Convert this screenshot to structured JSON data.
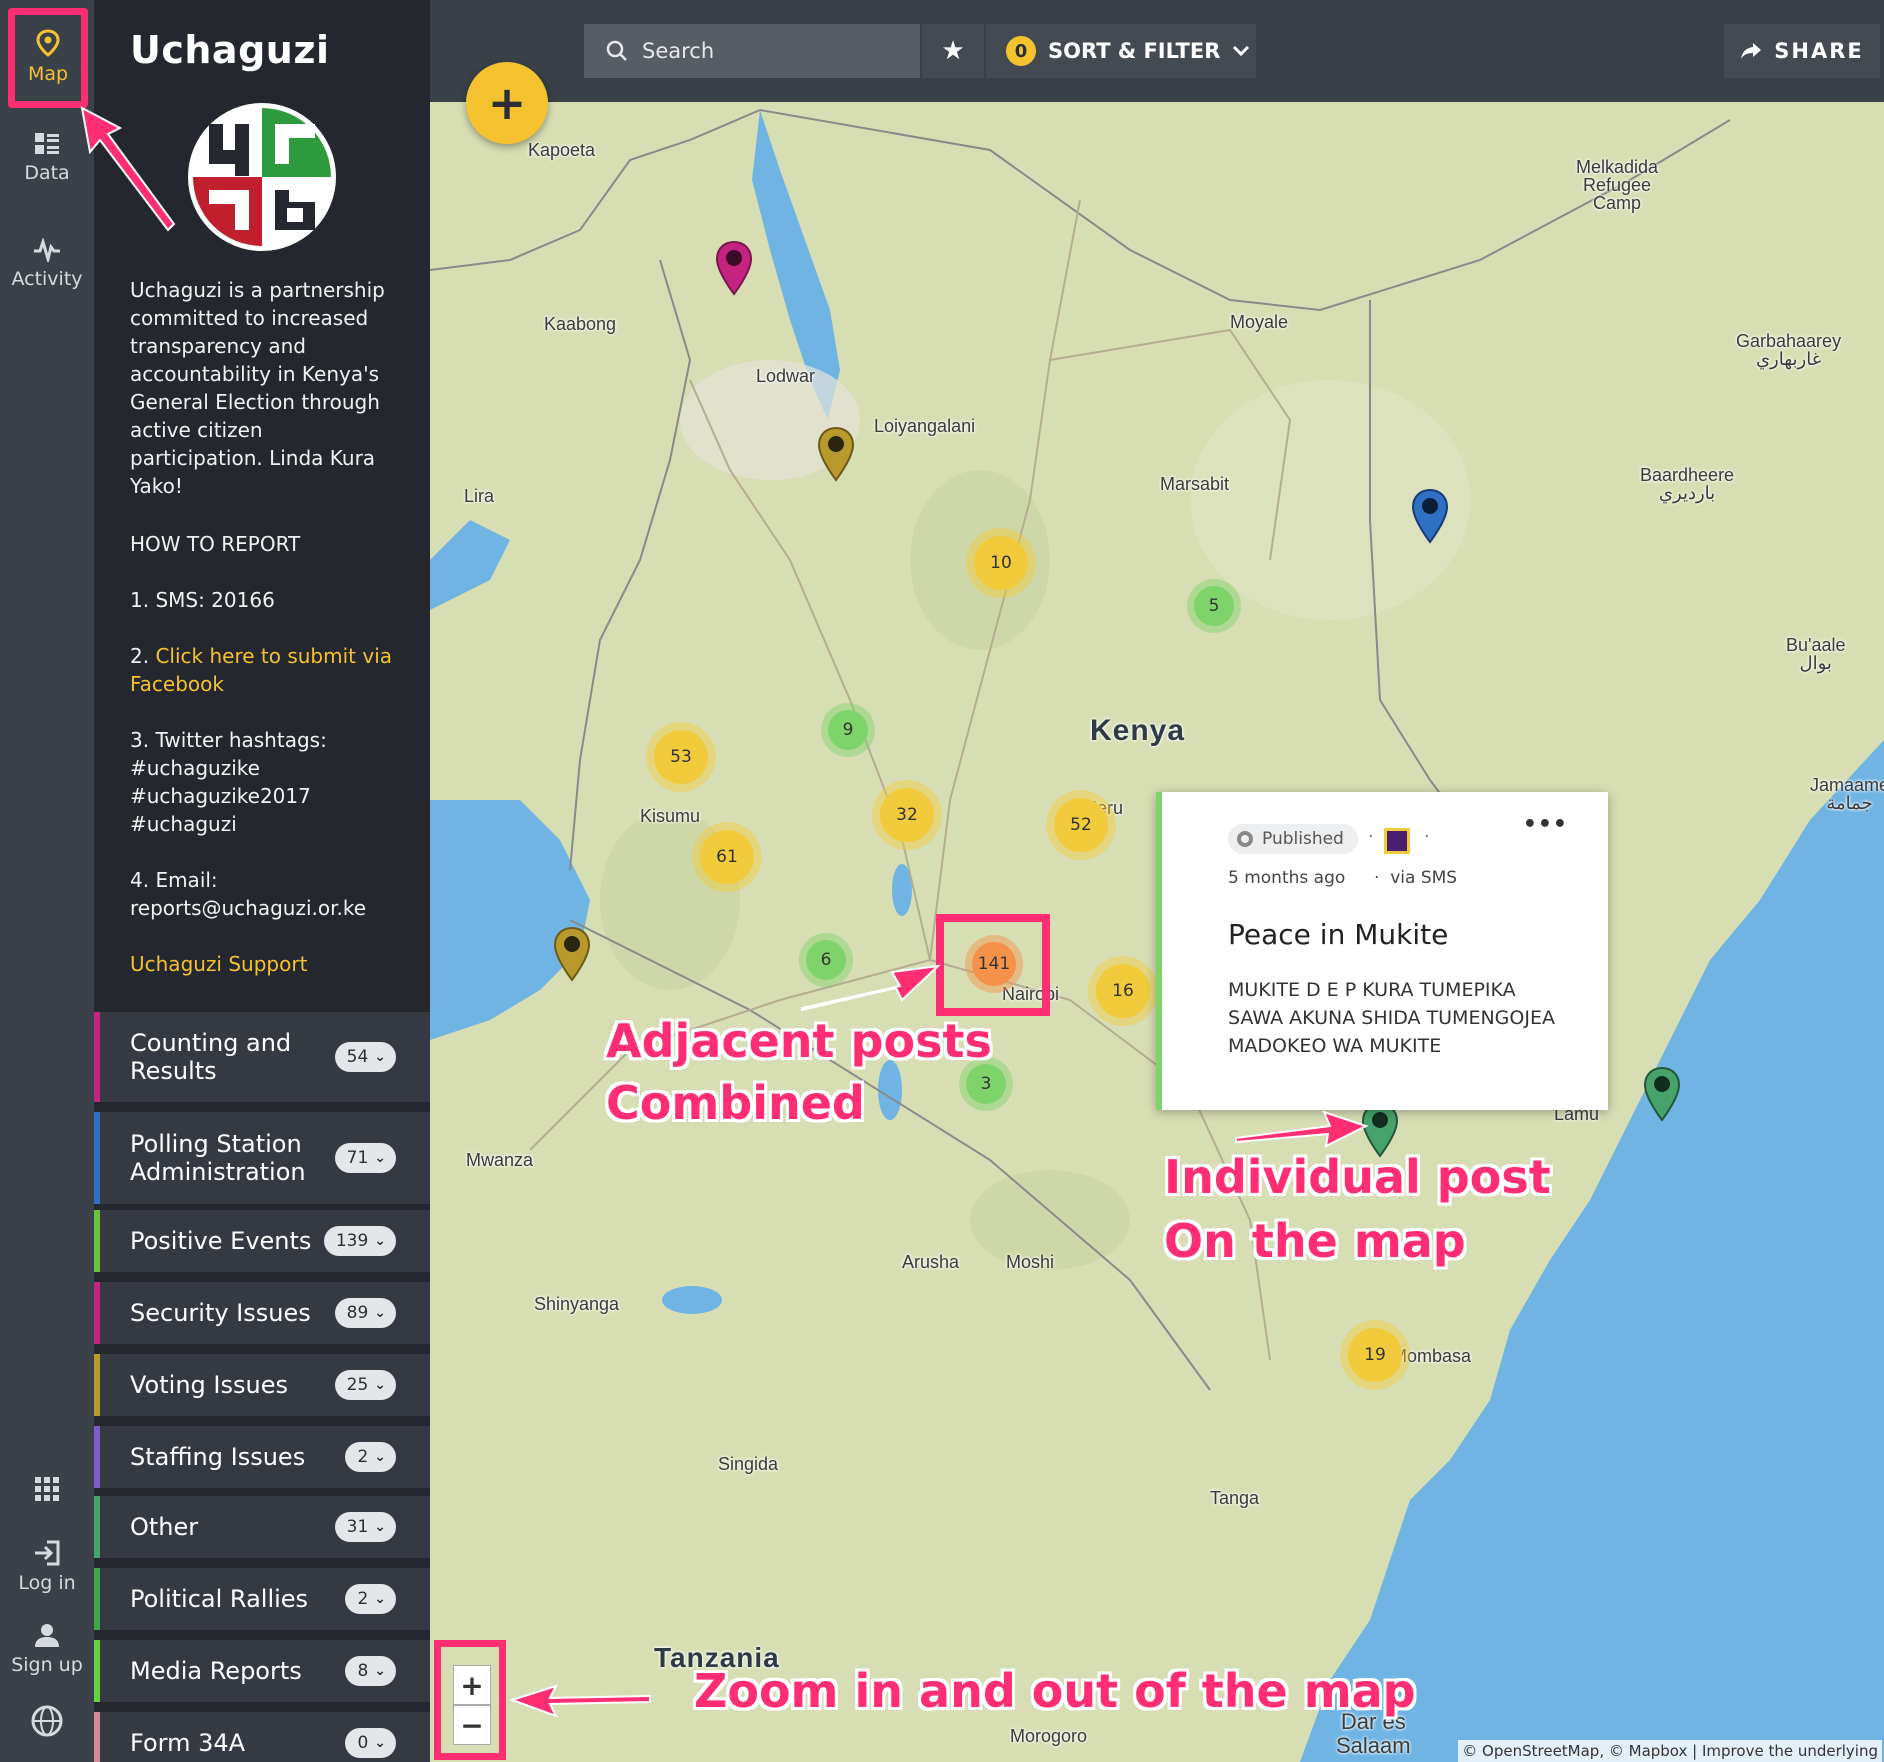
{
  "rail": {
    "map_label": "Map",
    "data_label": "Data",
    "activity_label": "Activity",
    "login_label": "Log in",
    "signup_label": "Sign up"
  },
  "sidebar": {
    "title": "Uchaguzi",
    "about": "Uchaguzi is a partnership committed to increased transparency and accountability in Kenya's General Election through active citizen participation. Linda Kura Yako!",
    "howto_heading": "HOW TO REPORT",
    "howto_sms": "1. SMS: 20166",
    "howto_fb_prefix": "2. ",
    "howto_fb_link": "Click here to submit via Facebook",
    "howto_twitter_label": "3. Twitter hashtags:",
    "howto_hashtags": [
      "#uchaguzike",
      "#uchaguzike2017",
      "#uchaguzi"
    ],
    "howto_email_label": "4. Email:",
    "howto_email": "reports@uchaguzi.or.ke",
    "support_link": "Uchaguzi Support",
    "categories": [
      {
        "label": "Counting and Results",
        "count": "54",
        "color": "#c4237f"
      },
      {
        "label": "Polling Station Administration",
        "count": "71",
        "color": "#2f6fc4"
      },
      {
        "label": "Positive Events",
        "count": "139",
        "color": "#6cc13a"
      },
      {
        "label": "Security Issues",
        "count": "89",
        "color": "#c4237f"
      },
      {
        "label": "Voting Issues",
        "count": "25",
        "color": "#b89a2c"
      },
      {
        "label": "Staffing Issues",
        "count": "2",
        "color": "#7d5ec7"
      },
      {
        "label": "Other",
        "count": "31",
        "color": "#47a36b"
      },
      {
        "label": "Political Rallies",
        "count": "2",
        "color": "#3fa64a"
      },
      {
        "label": "Media Reports",
        "count": "8",
        "color": "#65d13c"
      },
      {
        "label": "Form 34A",
        "count": "0",
        "color": "#d08a9a"
      }
    ]
  },
  "toolbar": {
    "search_placeholder": "Search",
    "filter_count": "0",
    "filter_label": "SORT & FILTER",
    "share_label": "SHARE",
    "add_label": "+"
  },
  "map": {
    "places": {
      "kapoeta": "Kapoeta",
      "melkadida": "Melkadida",
      "refugee": "Refugee",
      "camp": "Camp",
      "kaabong": "Kaabong",
      "moyale": "Moyale",
      "garbahaarey": "Garbahaarey",
      "garbahaarey_ar": "غاربهاري",
      "lodwar": "Lodwar",
      "loiyangalani": "Loiyangalani",
      "lira": "Lira",
      "marsabit": "Marsabit",
      "baardheere": "Baardheere",
      "baardheere_ar": "بارديري",
      "buaale": "Bu'aale",
      "buaale_ar": "بوال",
      "kenya": "Kenya",
      "meru": "Meru",
      "jamaame": "Jamaame",
      "jamaame_ar": "جمامة",
      "kisumu": "Kisumu",
      "nairobi": "Nairobi",
      "lamu": "Lamu",
      "mwanza": "Mwanza",
      "arusha": "Arusha",
      "moshi": "Moshi",
      "shinyanga": "Shinyanga",
      "mombasa": "Mombasa",
      "singida": "Singida",
      "tanga": "Tanga",
      "tanzania": "Tanzania",
      "morogoro": "Morogoro",
      "dar": "Dar es",
      "salaam": "Salaam"
    },
    "clusters": {
      "c10": "10",
      "c5": "5",
      "c9": "9",
      "c53": "53",
      "c32": "32",
      "c52": "52",
      "c61": "61",
      "c6": "6",
      "c141": "141",
      "c16": "16",
      "c3": "3",
      "c19": "19"
    },
    "attribution": "© OpenStreetMap, © Mapbox | Improve the underlying"
  },
  "post": {
    "status": "Published",
    "time": "5 months ago",
    "via": "via SMS",
    "title": "Peace in Mukite",
    "body": "MUKITE D E P KURA TUMEPIKA SAWA AKUNA SHIDA TUMENGOJEA MADOKEO WA MUKITE"
  },
  "annotations": {
    "adjacent_line1": "Adjacent posts",
    "adjacent_line2": "Combined",
    "individual_line1": "Individual post",
    "individual_line2": "On the map",
    "zoom": "Zoom in and out of the map",
    "color": "#ff2d72"
  }
}
